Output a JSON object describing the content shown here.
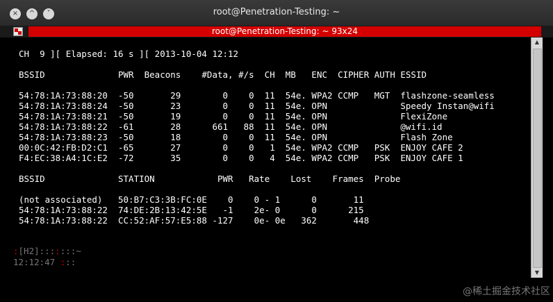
{
  "window": {
    "title": "root@Penetration-Testing: ~",
    "tab_label": "root@Penetration-Testing: ~ 93x24",
    "buttons": [
      "×",
      "^",
      "˅"
    ]
  },
  "terminal": {
    "status_line": "CH  9 ][ Elapsed: 16 s ][ 2013-10-04 12:12",
    "ap_header": "BSSID              PWR  Beacons    #Data, #/s  CH  MB   ENC  CIPHER AUTH ESSID",
    "ap_rows": [
      "54:78:1A:73:88:20  -50       29        0    0  11  54e. WPA2 CCMP   MGT  flashzone-seamless",
      "54:78:1A:73:88:24  -50       23        0    0  11  54e. OPN              Speedy Instan@wifi",
      "54:78:1A:73:88:21  -50       19        0    0  11  54e. OPN              FlexiZone",
      "54:78:1A:73:88:22  -61       28      661   88  11  54e. OPN              @wifi.id",
      "54:78:1A:73:88:23  -50       18        0    0  11  54e. OPN              Flash Zone",
      "00:0C:42:FB:D2:C1  -65       27        0    0   1  54e. WPA2 CCMP   PSK  ENJOY CAFE 2",
      "F4:EC:38:A4:1C:E2  -72       35        0    0   4  54e. WPA2 CCMP   PSK  ENJOY CAFE 1"
    ],
    "station_header": "BSSID              STATION            PWR   Rate    Lost    Frames  Probe",
    "station_rows": [
      "(not associated)   50:B7:C3:3B:FC:0E    0    0 - 1      0       11",
      "54:78:1A:73:88:22  74:DE:2B:13:42:5E   -1    2e- 0      0      215",
      "54:78:1A:73:88:22  CC:52:AF:57:E5:88 -127    0e- 0e   362       448"
    ]
  },
  "prompt": {
    "line1_a": ":",
    "line1_b": "[H2]",
    "line1_c": ":::",
    "line1_d": ":",
    "line1_e": ":::~",
    "line2_a": "12:12:47 ",
    "line2_b": ":",
    "line2_c": "::"
  },
  "watermark": "@稀土掘金技术社区",
  "colors": {
    "tab_accent": "#d40000",
    "terminal_bg": "#000000",
    "terminal_text": "#ffffff"
  }
}
